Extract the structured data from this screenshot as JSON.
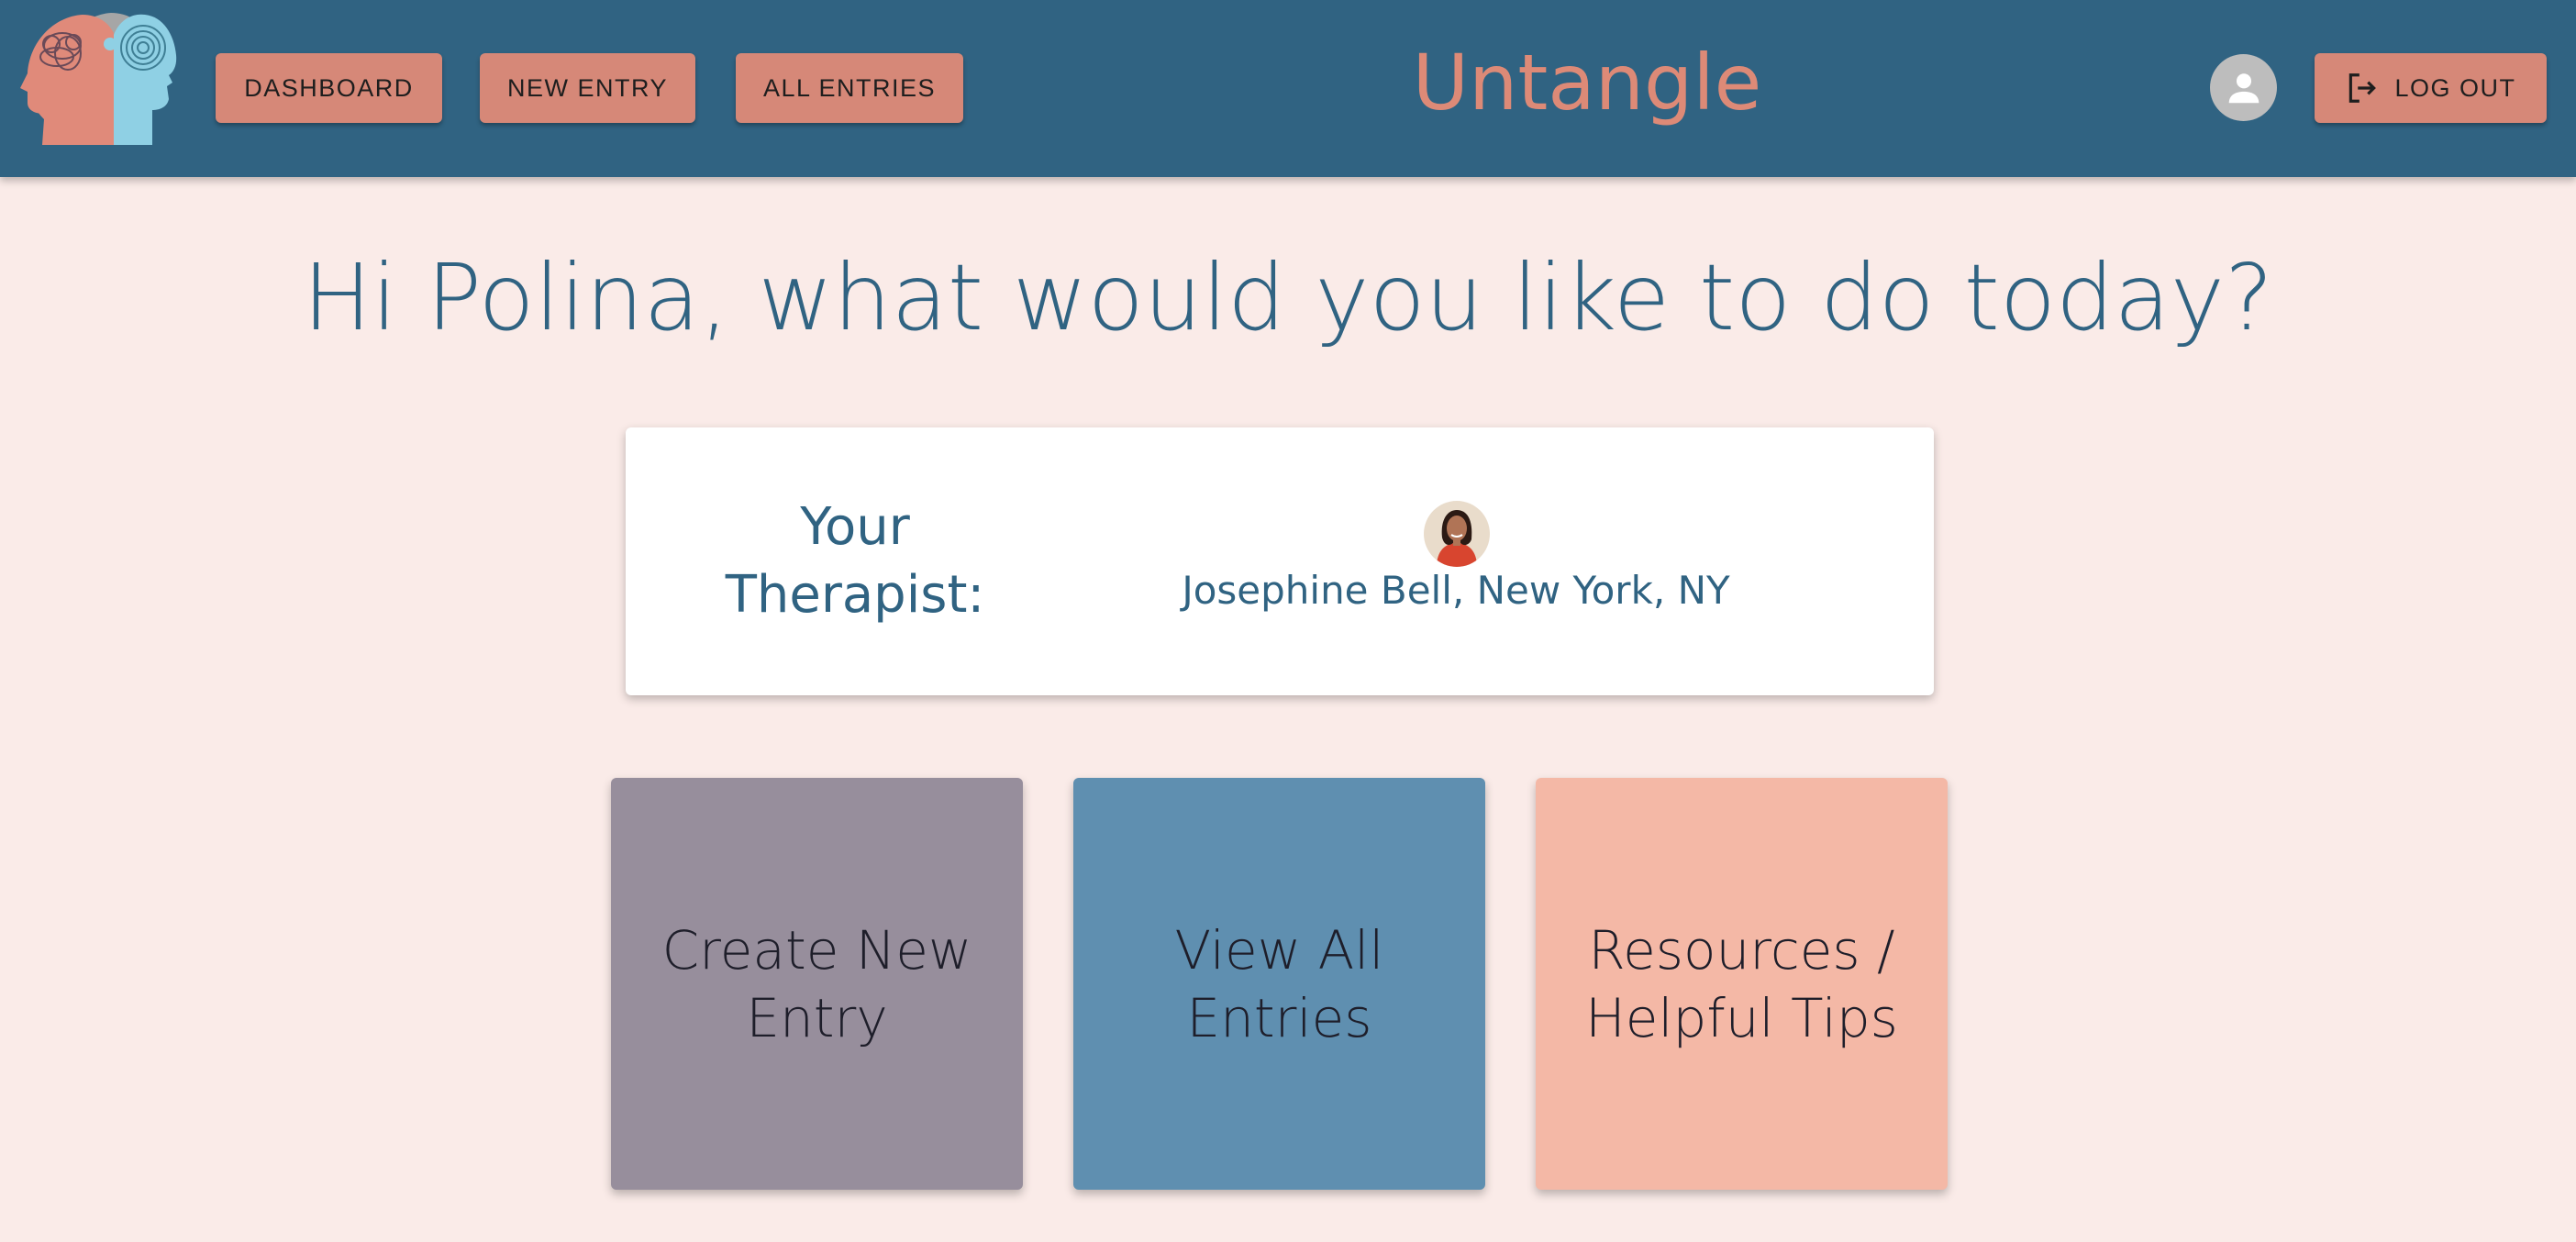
{
  "app": {
    "brand": "Untangle"
  },
  "nav": {
    "dashboard_label": "DASHBOARD",
    "new_entry_label": "NEW ENTRY",
    "all_entries_label": "ALL ENTRIES",
    "logout_label": "LOG OUT",
    "logout_icon": "logout-icon",
    "avatar_icon": "person-icon"
  },
  "main": {
    "greeting": "Hi Polina, what would you like to do today?",
    "therapist": {
      "label_line1": "Your",
      "label_line2": "Therapist:",
      "name": "Josephine Bell, New York, NY"
    },
    "tiles": [
      {
        "line1": "Create New",
        "line2": "Entry"
      },
      {
        "line1": "View All",
        "line2": "Entries"
      },
      {
        "line1": "Resources /",
        "line2": "Helpful Tips"
      }
    ]
  },
  "colors": {
    "header": "#306382",
    "accent": "#d68878",
    "background": "#faebe8",
    "tile_create": "#978e9c",
    "tile_view": "#5f8fb0",
    "tile_resources": "#f4b8a6"
  }
}
